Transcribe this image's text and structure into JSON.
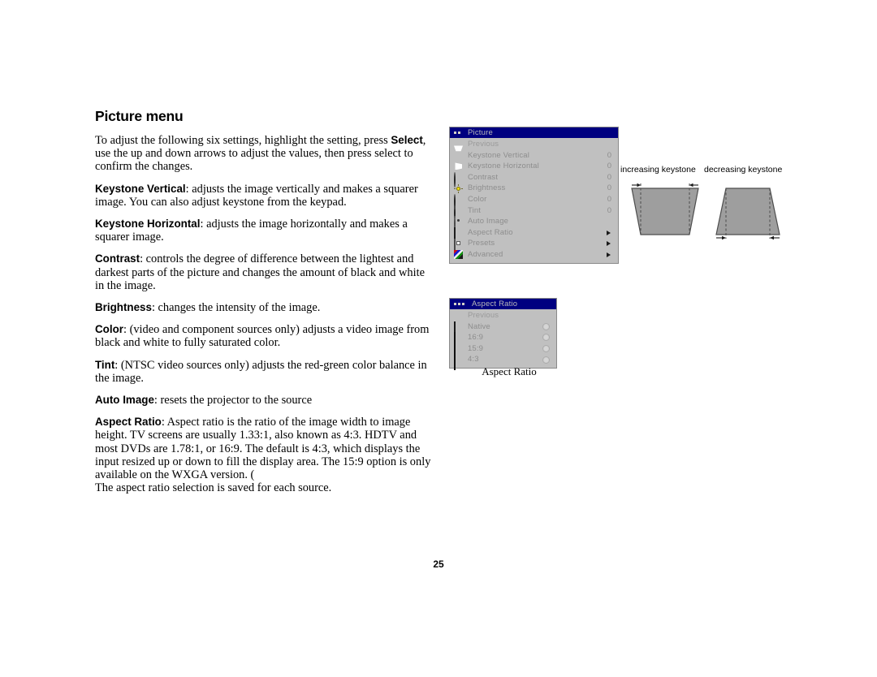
{
  "document": {
    "page_number": "25",
    "title": "Picture menu"
  },
  "body": {
    "intro": {
      "text": "To adjust the following six settings, highlight the setting, press Select, use the up and down arrows to adjust the values, then press select to confirm the changes.",
      "part1": "To adjust the following six settings, highlight the setting, press ",
      "bold": "Select",
      "part2": ", use the up and down arrows to adjust the values, then press select to confirm the changes."
    },
    "entries": [
      {
        "term": "Keystone Vertical",
        "text": ": adjusts the image vertically and makes a squarer image. You can also adjust keystone from the keypad."
      },
      {
        "term": "Keystone Horizontal",
        "text": ": adjusts the image horizontally and makes a squarer image."
      },
      {
        "term": "Contrast",
        "text": ": controls the degree of difference between the lightest and darkest parts of the picture and changes the amount of black and white in the image."
      },
      {
        "term": "Brightness",
        "text": ": changes the intensity of the image."
      },
      {
        "term": "Color",
        "text": ": (video and component sources only) adjusts a video image from black and white to fully saturated color."
      },
      {
        "term": "Tint",
        "text": ": (NTSC video sources only) adjusts the red-green color balance in the image."
      },
      {
        "term": "Auto Image",
        "text": ": resets the projector to the source"
      },
      {
        "term": "Aspect Ratio",
        "text": ": Aspect ratio is the ratio of the image width to image height. TV screens are usually 1.33:1, also known as 4:3. HDTV and most DVDs are 1.78:1, or 16:9. The default is 4:3, which displays the input resized up or down to fill the display area. The 15:9 option is only available on the WXGA version. (",
        "continuation": "The aspect ratio selection is saved for each source."
      }
    ]
  },
  "picture_menu": {
    "title": "Picture",
    "page_dots": 2,
    "title_bg": "#000080",
    "panel_bg": "#c0c0c0",
    "label_color": "#8d8d8d",
    "previous_label": "Previous",
    "items": [
      {
        "label": "Keystone Vertical",
        "icon": "keystone-vertical-icon",
        "value": "0",
        "arrow": false
      },
      {
        "label": "Keystone Horizontal",
        "icon": "keystone-horizontal-icon",
        "value": "0",
        "arrow": false
      },
      {
        "label": "Contrast",
        "icon": "contrast-icon",
        "value": "0",
        "arrow": false
      },
      {
        "label": "Brightness",
        "icon": "brightness-icon",
        "value": "0",
        "arrow": false
      },
      {
        "label": "Color",
        "icon": "color-icon",
        "value": "0",
        "arrow": false
      },
      {
        "label": "Tint",
        "icon": "tint-icon",
        "value": "0",
        "arrow": false
      },
      {
        "label": "Auto Image",
        "icon": "auto-image-icon",
        "value": "",
        "arrow": false
      },
      {
        "label": "Aspect Ratio",
        "icon": "aspect-ratio-icon",
        "value": "",
        "arrow": true
      },
      {
        "label": "Presets",
        "icon": "presets-icon",
        "value": "",
        "arrow": true
      },
      {
        "label": "Advanced",
        "icon": "advanced-icon",
        "value": "",
        "arrow": true
      }
    ]
  },
  "aspect_menu": {
    "title": "Aspect Ratio",
    "page_dots": 3,
    "previous_label": "Previous",
    "caption": "Aspect Ratio",
    "items": [
      {
        "label": "Native",
        "icon": "white-swatch-icon",
        "selected": false
      },
      {
        "label": "16:9",
        "icon": "black-swatch-icon",
        "selected": false
      },
      {
        "label": "15:9",
        "icon": "black-swatch-icon",
        "selected": false
      },
      {
        "label": "4:3",
        "icon": "black-swatch-icon",
        "selected": false
      }
    ]
  },
  "keystone_figure": {
    "increasing_label": "increasing keystone",
    "decreasing_label": "decreasing keystone",
    "fill_color": "#9e9e9e",
    "stroke_color": "#4d4d4d"
  }
}
